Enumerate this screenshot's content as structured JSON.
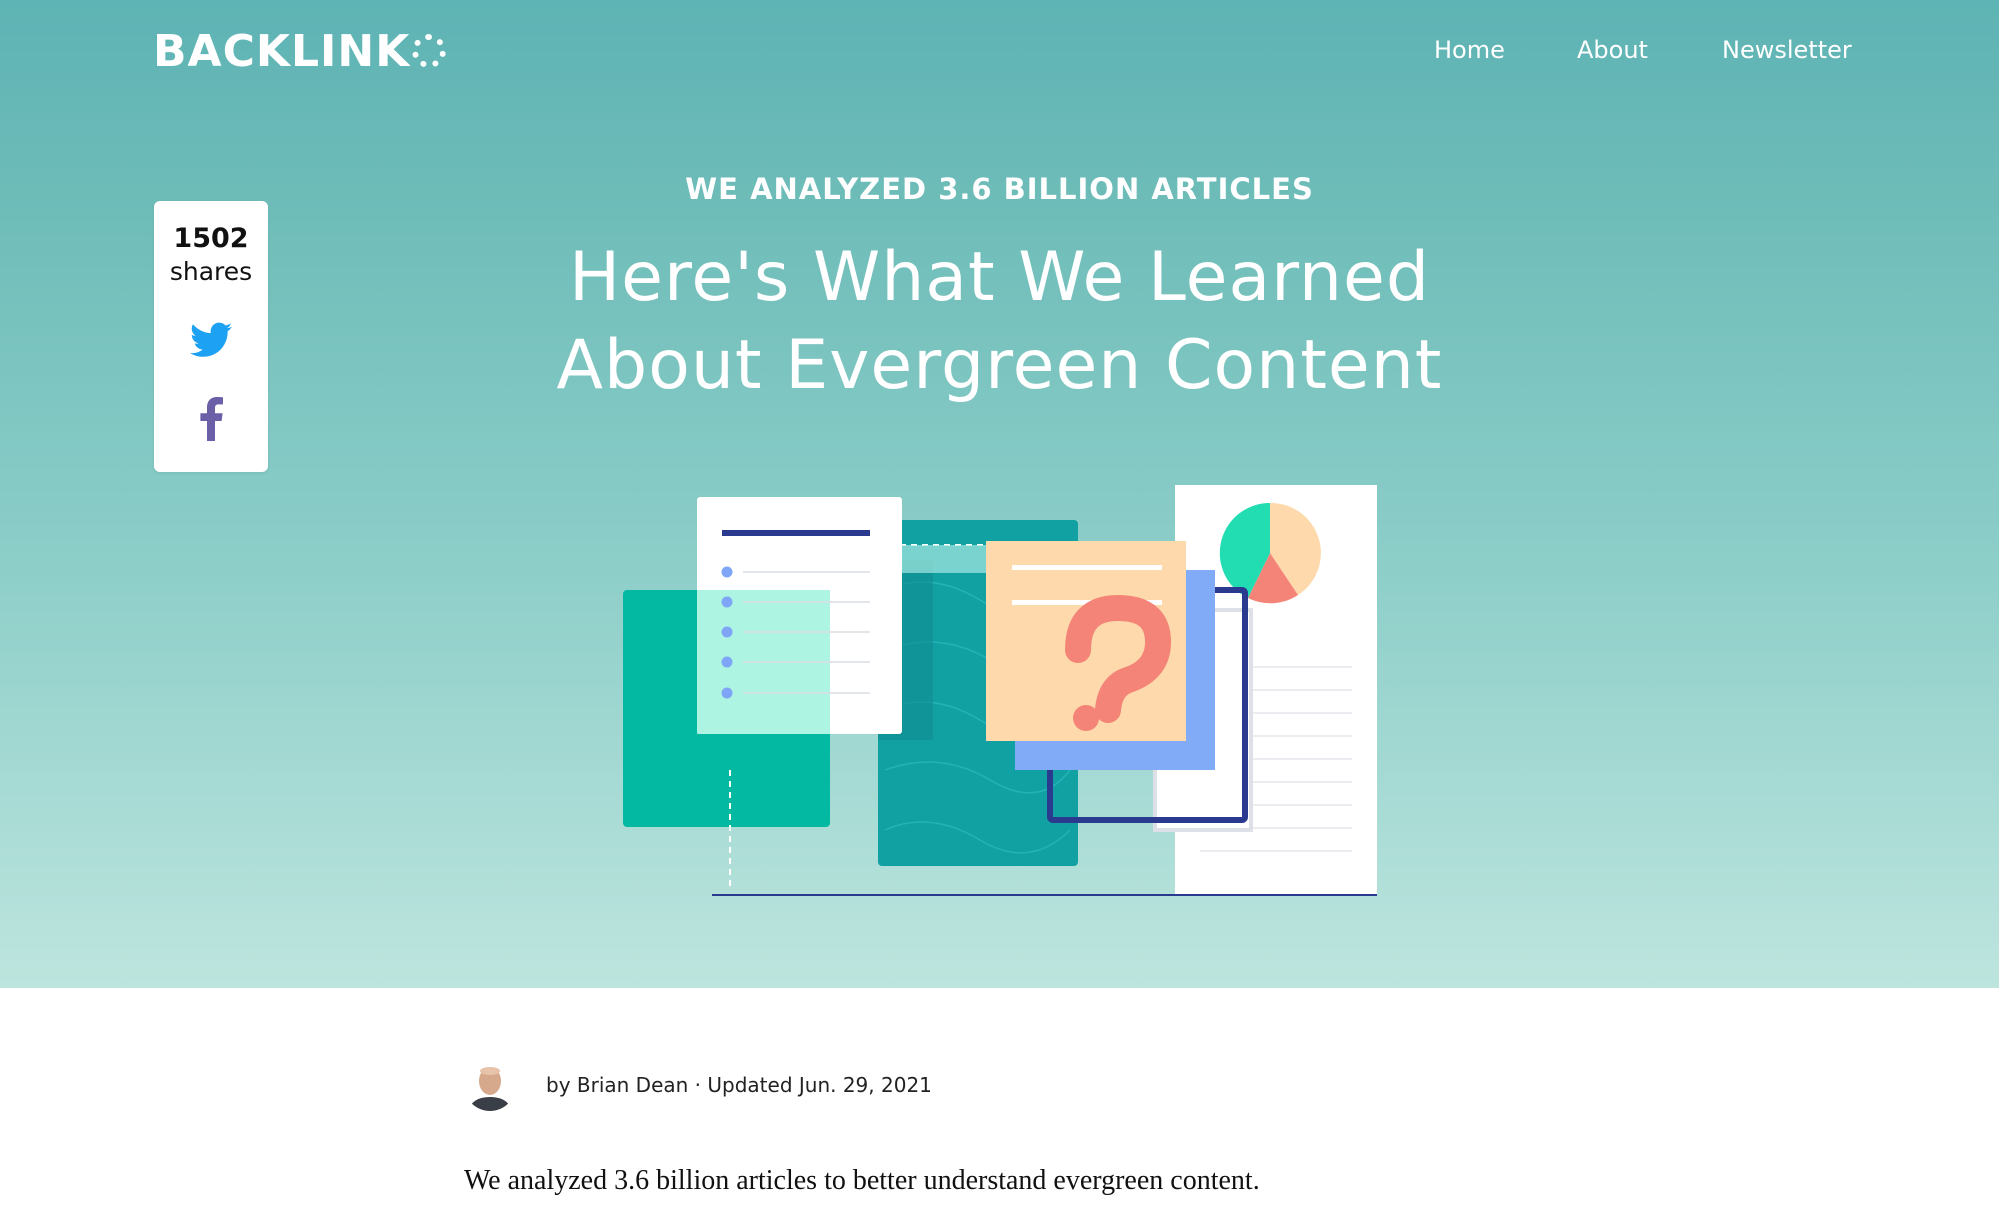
{
  "header": {
    "logo_text": "BACKLINK",
    "nav": [
      "Home",
      "About",
      "Newsletter"
    ]
  },
  "share": {
    "count": "1502",
    "label": "shares",
    "icons": [
      "twitter-icon",
      "facebook-icon"
    ]
  },
  "hero": {
    "kicker": "WE ANALYZED 3.6 BILLION ARTICLES",
    "title_line1": "Here's What We Learned",
    "title_line2": "About Evergreen Content"
  },
  "byline": {
    "text": "by Brian Dean · Updated Jun. 29, 2021"
  },
  "article": {
    "intro": "We analyzed 3.6 billion articles to better understand evergreen content."
  },
  "colors": {
    "hero_top": "#5eb3b4",
    "hero_bottom": "#bde5de",
    "twitter": "#1da1f2",
    "facebook": "#6b5fa7"
  }
}
